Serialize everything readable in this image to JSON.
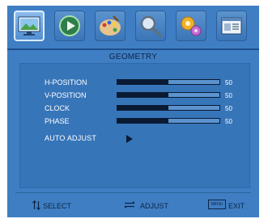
{
  "tabs": [
    {
      "name": "picture",
      "icon": "monitor-landscape-icon"
    },
    {
      "name": "playback",
      "icon": "play-circle-icon"
    },
    {
      "name": "color",
      "icon": "paint-palette-icon"
    },
    {
      "name": "zoom",
      "icon": "magnifier-icon"
    },
    {
      "name": "settings",
      "icon": "gears-icon"
    },
    {
      "name": "information",
      "icon": "document-window-icon"
    }
  ],
  "menu": {
    "title": "GEOMETRY",
    "rows": [
      {
        "label": "H-POSITION",
        "value": "50",
        "level": 0.5
      },
      {
        "label": "V-POSITION",
        "value": "50",
        "level": 0.5
      },
      {
        "label": "CLOCK",
        "value": "50",
        "level": 0.5
      },
      {
        "label": "PHASE",
        "value": "50",
        "level": 0.5
      }
    ],
    "auto_adjust": "AUTO  ADJUST"
  },
  "footer": {
    "select": "SELECT",
    "adjust": "ADJUST",
    "menu_key": "MENU",
    "exit": "EXIT"
  },
  "colors": {
    "background": "#3f7ec3",
    "text_dark": "#0d2546",
    "bar_fill": "#0a1a33"
  }
}
